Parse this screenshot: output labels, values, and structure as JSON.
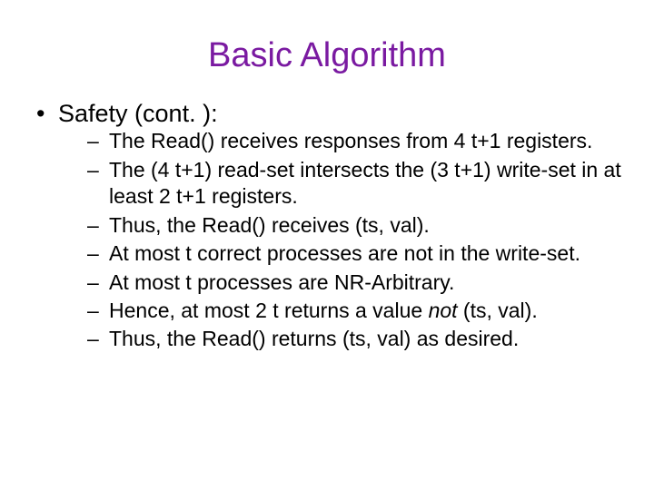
{
  "slide": {
    "title": "Basic Algorithm",
    "heading": "Safety (cont. ):",
    "points": {
      "p0": "The Read() receives responses from 4 t+1 registers.",
      "p1": "The (4 t+1) read-set intersects the (3 t+1) write-set in at least 2 t+1 registers.",
      "p2": "Thus, the Read() receives (ts, val).",
      "p3": "At most t correct processes are not in the write-set.",
      "p4": "At most t processes are NR-Arbitrary.",
      "p5_a": "Hence, at most 2 t returns a value ",
      "p5_not": "not",
      "p5_b": " (ts, val).",
      "p6": "Thus, the Read() returns (ts, val) as desired."
    }
  }
}
